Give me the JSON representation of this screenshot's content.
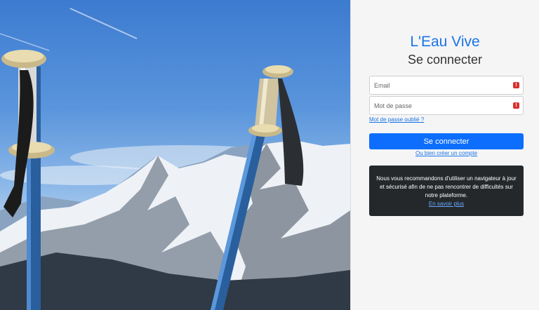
{
  "brand": {
    "name": "L'Eau Vive",
    "color": "#1a74e6"
  },
  "login": {
    "title": "Se connecter",
    "email_placeholder": "Email",
    "password_placeholder": "Mot de passe",
    "alert_glyph": "!",
    "forgot_label": "Mot de passe oublié ?",
    "submit_label": "Se connecter",
    "create_label": "Ou bien créer un compte"
  },
  "notice": {
    "text": "Nous vous recommandons d'utiliser un navigateur à jour et sécurisé afin de ne pas rencontrer de difficultés sur notre plateforme.",
    "link_label": "En savoir plus"
  },
  "colors": {
    "primary_button": "#0d6efd",
    "notice_bg": "#24282b",
    "alert": "#d9322f"
  },
  "hero": {
    "icon": "ski-poles-mountain-photo"
  }
}
